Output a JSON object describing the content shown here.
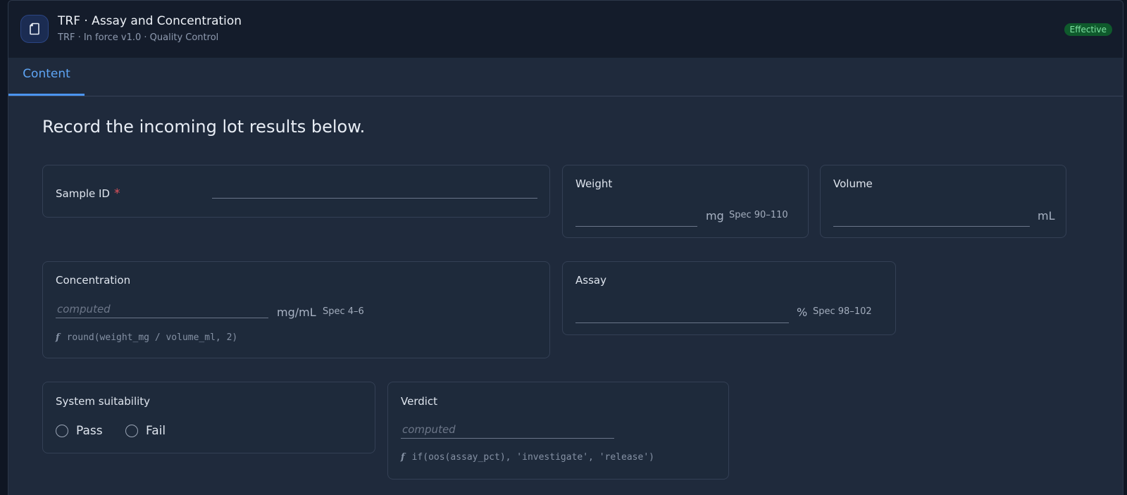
{
  "header": {
    "title": "TRF · Assay and Concentration",
    "subtitle": "TRF · In force v1.0 · Quality Control",
    "status_badge": "Effective",
    "icon": "document-icon"
  },
  "tabs": [
    {
      "label": "Content",
      "active": true
    }
  ],
  "intro_text": "Record the incoming lot results below.",
  "fields": {
    "sample_id": {
      "label": "Sample ID",
      "required_mark": "*",
      "value": ""
    },
    "weight": {
      "label": "Weight",
      "unit": "mg",
      "spec": "Spec 90–110",
      "value": ""
    },
    "volume": {
      "label": "Volume",
      "unit": "mL",
      "value": ""
    },
    "concentration": {
      "label": "Concentration",
      "placeholder": "computed",
      "unit": "mg/mL",
      "spec": "Spec 4–6",
      "formula_symbol": "f",
      "formula": "round(weight_mg / volume_ml, 2)"
    },
    "assay": {
      "label": "Assay",
      "unit": "%",
      "spec": "Spec 98–102",
      "value": ""
    },
    "system_suitability": {
      "label": "System suitability",
      "options": [
        "Pass",
        "Fail"
      ]
    },
    "verdict": {
      "label": "Verdict",
      "placeholder": "computed",
      "formula_symbol": "f",
      "formula": "if(oos(assay_pct), 'investigate', 'release')"
    }
  },
  "colors": {
    "accent": "#4b94ef",
    "badge_bg": "#0f5a2c",
    "badge_text": "#7ee2a2",
    "required": "#e0525b",
    "background": "#1f2a3c"
  }
}
